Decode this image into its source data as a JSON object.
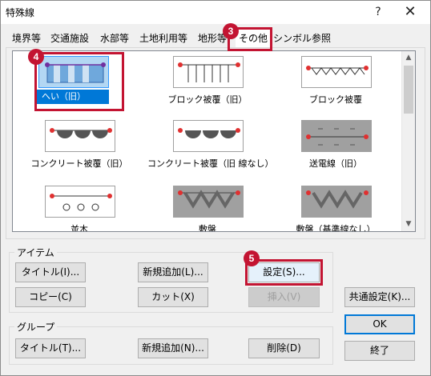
{
  "window": {
    "title": "特殊線",
    "help_glyph": "?",
    "close_glyph": "✕"
  },
  "tabs": [
    {
      "label": "境界等"
    },
    {
      "label": "交通施設"
    },
    {
      "label": "水部等"
    },
    {
      "label": "土地利用等"
    },
    {
      "label": "地形等"
    },
    {
      "label": "その他",
      "active": true
    },
    {
      "label": "シンボル参照"
    }
  ],
  "gallery": {
    "items": [
      {
        "label": "へい（旧）",
        "selected": true
      },
      {
        "label": "ブロック被覆（旧）"
      },
      {
        "label": "ブロック被覆"
      },
      {
        "label": "コンクリート被覆（旧）"
      },
      {
        "label": "コンクリート被覆（旧 線なし）"
      },
      {
        "label": "送電線（旧）"
      },
      {
        "label": "並木"
      },
      {
        "label": "敷盤"
      },
      {
        "label": "敷盤（基準線なし）"
      }
    ],
    "scroll_up_glyph": "▲",
    "scroll_down_glyph": "▼"
  },
  "callouts": {
    "tab_badge": "3",
    "item_badge": "4",
    "settings_badge": "5"
  },
  "item_group": {
    "label": "アイテム",
    "title_button": "タイトル(I)...",
    "new_button": "新規追加(L)...",
    "settings_button": "設定(S)...",
    "copy_button": "コピー(C)",
    "cut_button": "カット(X)",
    "insert_button": "挿入(V)"
  },
  "group_group": {
    "label": "グループ",
    "title_button": "タイトル(T)...",
    "new_button": "新規追加(N)...",
    "delete_button": "削除(D)"
  },
  "side_buttons": {
    "common_settings": "共通設定(K)...",
    "ok": "OK",
    "close": "終了"
  },
  "colors": {
    "accent": "#0078d7",
    "callout": "#c31432",
    "selection_bg": "#b3d7f3",
    "marker": "#e03030"
  }
}
